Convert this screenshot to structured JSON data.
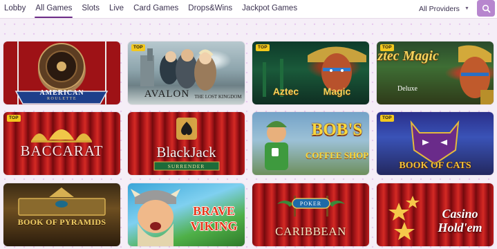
{
  "nav": {
    "items": [
      {
        "label": "Lobby",
        "active": false
      },
      {
        "label": "All Games",
        "active": true
      },
      {
        "label": "Slots",
        "active": false
      },
      {
        "label": "Live",
        "active": false
      },
      {
        "label": "Card Games",
        "active": false
      },
      {
        "label": "Drops&Wins",
        "active": false
      },
      {
        "label": "Jackpot Games",
        "active": false
      }
    ],
    "providers_label": "All Providers",
    "search_icon": "search-icon"
  },
  "badge_label": "TOP",
  "games": [
    {
      "title_line1": "AMERICAN",
      "title_line2": "ROULETTE",
      "top": false
    },
    {
      "title_line1": "AVALON",
      "title_line2": "THE LOST KINGDOM",
      "top": true
    },
    {
      "title_line1": "Aztec",
      "title_line2": "Magic",
      "top": true
    },
    {
      "title_line1": "Aztec Magic",
      "title_line2": "Deluxe",
      "top": true
    },
    {
      "title_line1": "BACCARAT",
      "title_line2": "",
      "top": true
    },
    {
      "title_line1": "BlackJack",
      "title_line2": "SURRENDER",
      "top": false
    },
    {
      "title_line1": "BOB'S",
      "title_line2": "COFFEE SHOP",
      "top": false
    },
    {
      "title_line1": "BOOK OF CATS",
      "title_line2": "",
      "top": true
    },
    {
      "title_line1": "BOOK OF PYRAMIDS",
      "title_line2": "",
      "top": false
    },
    {
      "title_line1": "BRAVE",
      "title_line2": "VIKING",
      "top": false
    },
    {
      "title_line1": "POKER",
      "title_line2": "CARIBBEAN",
      "top": false
    },
    {
      "title_line1": "Casino",
      "title_line2": "Hold'em",
      "top": false
    }
  ],
  "colors": {
    "accent": "#6b2b86",
    "search_button": "#b786ce",
    "badge": "#f3c81d"
  }
}
